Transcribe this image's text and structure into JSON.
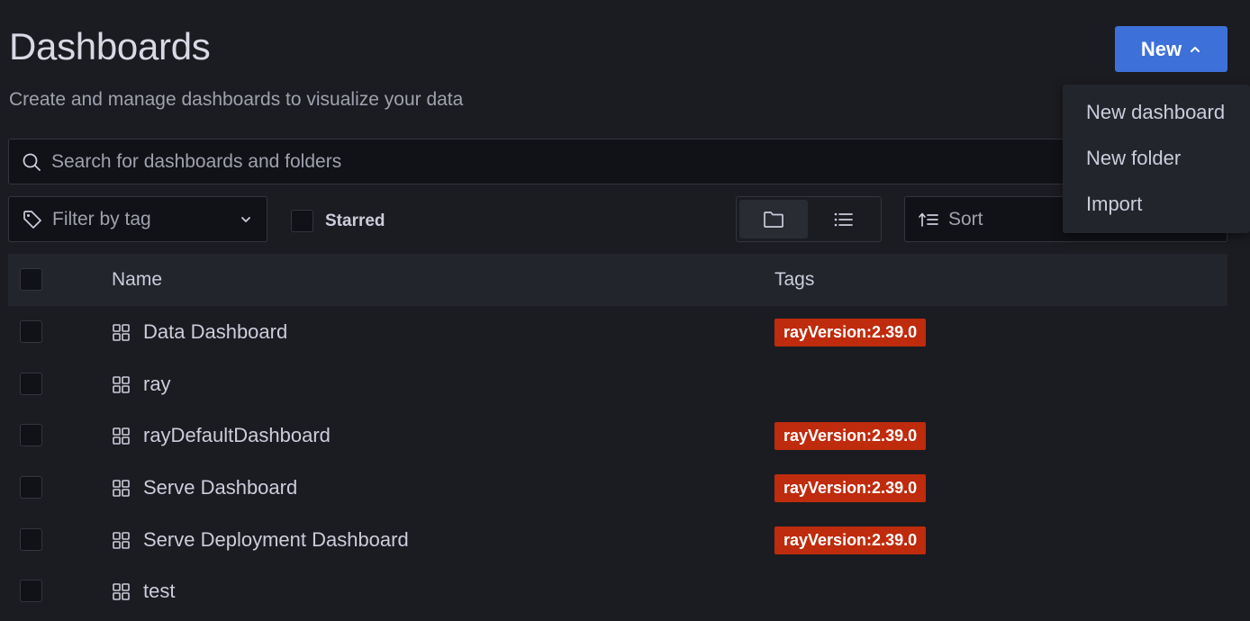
{
  "page": {
    "title": "Dashboards",
    "subtitle": "Create and manage dashboards to visualize your data"
  },
  "new_button": {
    "label": "New"
  },
  "new_menu": {
    "items": [
      {
        "label": "New dashboard"
      },
      {
        "label": "New folder"
      },
      {
        "label": "Import"
      }
    ]
  },
  "search": {
    "placeholder": "Search for dashboards and folders",
    "value": ""
  },
  "tag_filter": {
    "placeholder": "Filter by tag"
  },
  "starred": {
    "label": "Starred",
    "checked": false
  },
  "view_toggle": {
    "active": "folder-view"
  },
  "sort": {
    "placeholder": "Sort"
  },
  "table": {
    "headers": {
      "name": "Name",
      "tags": "Tags"
    },
    "rows": [
      {
        "name": "Data Dashboard",
        "tag": "rayVersion:2.39.0"
      },
      {
        "name": "ray",
        "tag": ""
      },
      {
        "name": "rayDefaultDashboard",
        "tag": "rayVersion:2.39.0"
      },
      {
        "name": "Serve Dashboard",
        "tag": "rayVersion:2.39.0"
      },
      {
        "name": "Serve Deployment Dashboard",
        "tag": "rayVersion:2.39.0"
      },
      {
        "name": "test",
        "tag": ""
      }
    ]
  },
  "colors": {
    "background": "#1b1c21",
    "primary_button": "#3d71d9",
    "tag_background": "#bf2b0d",
    "header_row": "#22252b"
  },
  "icons": {
    "search": "search-icon",
    "tag": "tag-icon",
    "chevron_down": "chevron-down-icon",
    "chevron_up": "chevron-up-icon",
    "folder_view": "folder-icon",
    "list_view": "list-icon",
    "sort": "sort-icon",
    "dashboard": "dashboard-grid-icon"
  }
}
